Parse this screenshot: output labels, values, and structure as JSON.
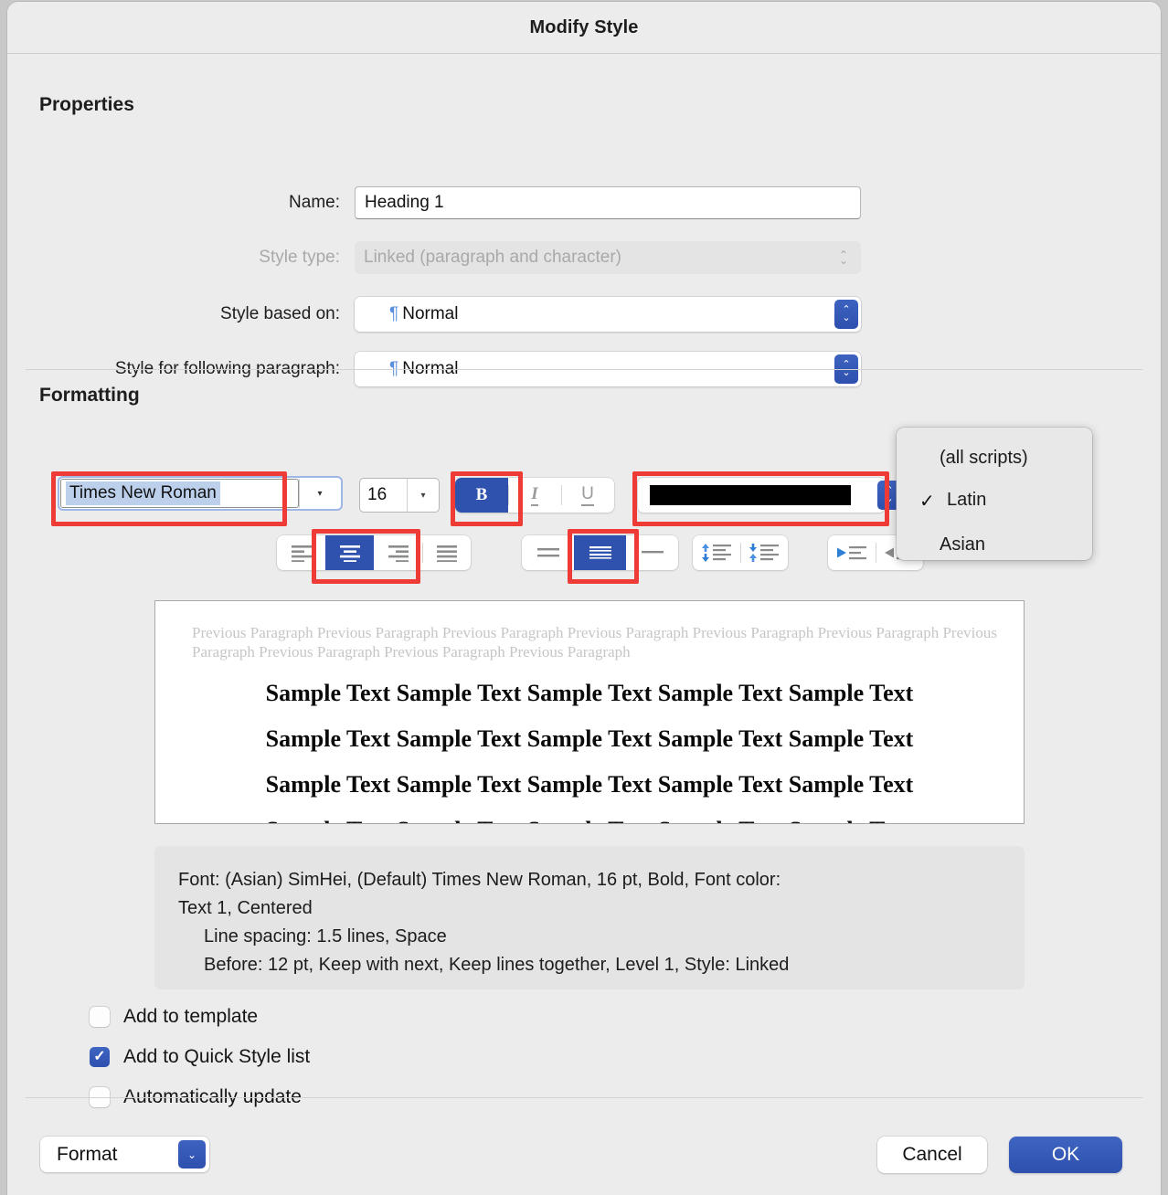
{
  "window": {
    "title": "Modify Style"
  },
  "sections": {
    "properties_title": "Properties",
    "formatting_title": "Formatting"
  },
  "properties": {
    "name_label": "Name:",
    "name_value": "Heading 1",
    "style_type_label": "Style type:",
    "style_type_value": "Linked (paragraph and character)",
    "style_based_on_label": "Style based on:",
    "style_based_on_value": "Normal",
    "style_following_label": "Style for following paragraph:",
    "style_following_value": "Normal",
    "pilcrow": "¶"
  },
  "formatting": {
    "font_name": "Times New Roman",
    "font_size": "16",
    "bold_label": "B",
    "italic_label": "I",
    "underline_label": "U",
    "font_color_hex": "#000000",
    "accent_hex": "#2f52ae",
    "highlight_hex": "#bcd0ec",
    "alignment_active": "center",
    "line_spacing_active": "1.5",
    "alignment_options": [
      "align-left",
      "align-center",
      "align-right",
      "align-justify"
    ],
    "line_spacing_options": [
      "line-spacing-single",
      "line-spacing-1-5",
      "line-spacing-double"
    ],
    "spacing_options": [
      "decrease-space-before",
      "increase-space-after"
    ],
    "indent_options": [
      "decrease-indent",
      "increase-indent"
    ]
  },
  "script_menu": {
    "header": "(all scripts)",
    "items": [
      {
        "label": "Latin",
        "checked": true
      },
      {
        "label": "Asian",
        "checked": false
      }
    ],
    "check_glyph": "✓"
  },
  "preview": {
    "previous_paragraph": "Previous Paragraph Previous Paragraph Previous Paragraph Previous Paragraph Previous Paragraph Previous Paragraph Previous Paragraph Previous Paragraph Previous Paragraph Previous Paragraph",
    "sample_lines": [
      "Sample Text Sample Text Sample Text Sample Text Sample Text",
      "Sample Text Sample Text Sample Text Sample Text Sample Text",
      "Sample Text Sample Text Sample Text Sample Text Sample Text",
      "Sample Text Sample Text Sample Text Sample Text Sample Text"
    ]
  },
  "description": {
    "line1": "Font: (Asian) SimHei, (Default) Times New Roman, 16 pt, Bold, Font color:",
    "line2": "Text 1, Centered",
    "line3": "Line spacing:  1.5 lines, Space",
    "line4": "Before:  12 pt, Keep with next, Keep lines together, Level 1, Style: Linked"
  },
  "checkboxes": [
    {
      "label": "Add to template",
      "checked": false
    },
    {
      "label": "Add to Quick Style list",
      "checked": true
    },
    {
      "label": "Automatically update",
      "checked": false
    }
  ],
  "footer": {
    "format_label": "Format",
    "cancel_label": "Cancel",
    "ok_label": "OK"
  },
  "glyphs": {
    "chevron_down": "▾",
    "chevron_up_small": "⌃",
    "chevron_down_small": "⌄",
    "check": "✓"
  }
}
